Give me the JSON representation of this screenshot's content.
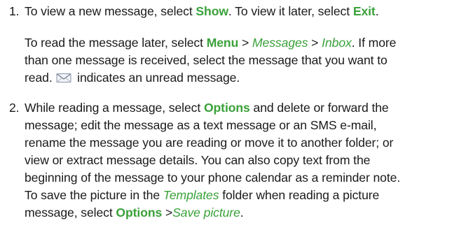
{
  "steps": [
    {
      "number": "1.",
      "paragraphs": [
        {
          "lines": [
            [
              {
                "t": "To view a new message, select "
              },
              {
                "t": "Show",
                "s": "cmd"
              },
              {
                "t": ". To view it later, select "
              },
              {
                "t": "Exit",
                "s": "cmd"
              },
              {
                "t": "."
              }
            ]
          ]
        },
        {
          "lines": [
            [
              {
                "t": "To read the message later, select "
              },
              {
                "t": "Menu",
                "s": "cmd"
              },
              {
                "t": " > "
              },
              {
                "t": "Messages",
                "s": "ital"
              },
              {
                "t": " > "
              },
              {
                "t": "Inbox",
                "s": "ital"
              },
              {
                "t": ". If more"
              }
            ],
            [
              {
                "t": "than one message is received, select the message that you want to"
              }
            ],
            [
              {
                "t": "read. "
              },
              {
                "icon": "envelope-icon"
              },
              {
                "t": " indicates an unread message."
              }
            ]
          ]
        }
      ]
    },
    {
      "number": "2.",
      "paragraphs": [
        {
          "lines": [
            [
              {
                "t": "While reading a message, select "
              },
              {
                "t": "Options",
                "s": "cmd"
              },
              {
                "t": " and delete or forward the"
              }
            ],
            [
              {
                "t": "message; edit the message as a text message or an SMS e-mail,"
              }
            ],
            [
              {
                "t": "rename the message you are reading or move it to another folder; or"
              }
            ],
            [
              {
                "t": "view or extract message details. You can also copy text from the"
              }
            ],
            [
              {
                "t": "beginning of the message to your phone calendar as a reminder note."
              }
            ],
            [
              {
                "t": "To save the picture in the "
              },
              {
                "t": "Templates",
                "s": "ital"
              },
              {
                "t": " folder when reading a picture"
              }
            ],
            [
              {
                "t": "message, select "
              },
              {
                "t": "Options",
                "s": "cmd"
              },
              {
                "t": " >"
              },
              {
                "t": "Save picture",
                "s": "ital"
              },
              {
                "t": "."
              }
            ]
          ]
        }
      ]
    }
  ],
  "colors": {
    "command_text": "#3aa13a",
    "body_text": "#1a1a1a"
  }
}
